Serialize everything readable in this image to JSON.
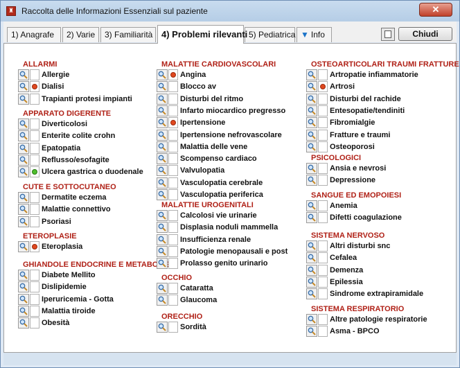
{
  "window": {
    "title": "Raccolta delle Informazioni Essenziali sul paziente"
  },
  "tabs": [
    {
      "label": "1) Anagrafe",
      "active": false
    },
    {
      "label": "2) Varie",
      "active": false
    },
    {
      "label": "3) Familiarità",
      "active": false
    },
    {
      "label": "4) Problemi rilevanti",
      "active": true
    },
    {
      "label": "5) Pediatrica",
      "active": false
    },
    {
      "label": "Info",
      "active": false
    }
  ],
  "toolbar": {
    "close_label": "Chiudi",
    "calculator_icon": "calculator-icon"
  },
  "colors": {
    "category": "#b02117",
    "dot_red": "#e0481f",
    "dot_green": "#4fbf2d"
  },
  "categories": [
    {
      "title": "ALLARMI",
      "items": [
        {
          "label": "Allergie",
          "status": "none"
        },
        {
          "label": "Dialisi",
          "status": "red"
        },
        {
          "label": "Trapianti protesi impianti",
          "status": "none"
        }
      ]
    },
    {
      "title": "APPARATO DIGERENTE",
      "items": [
        {
          "label": "Diverticolosi",
          "status": "none"
        },
        {
          "label": "Enterite colite crohn",
          "status": "none"
        },
        {
          "label": "Epatopatia",
          "status": "none"
        },
        {
          "label": "Reflusso/esofagite",
          "status": "none"
        },
        {
          "label": "Ulcera gastrica o duodenale",
          "status": "green"
        }
      ]
    },
    {
      "title": "CUTE E SOTTOCUTANEO",
      "items": [
        {
          "label": "Dermatite eczema",
          "status": "none"
        },
        {
          "label": "Malattie connettivo",
          "status": "none"
        },
        {
          "label": "Psoriasi",
          "status": "none"
        }
      ]
    },
    {
      "title": "ETEROPLASIE",
      "items": [
        {
          "label": "Eteroplasia",
          "status": "red"
        }
      ]
    },
    {
      "title": "GHIANDOLE ENDOCRINE E METABOLISM",
      "items": [
        {
          "label": "Diabete Mellito",
          "status": "none"
        },
        {
          "label": "Dislipidemie",
          "status": "none"
        },
        {
          "label": "Iperuricemia - Gotta",
          "status": "none"
        },
        {
          "label": "Malattia tiroide",
          "status": "none"
        },
        {
          "label": "Obesità",
          "status": "none"
        }
      ]
    },
    {
      "title": "MALATTIE CARDIOVASCOLARI",
      "items": [
        {
          "label": "Angina",
          "status": "red"
        },
        {
          "label": "Blocco av",
          "status": "none"
        },
        {
          "label": "Disturbi del ritmo",
          "status": "none"
        },
        {
          "label": "Infarto miocardico pregresso",
          "status": "none"
        },
        {
          "label": "Ipertensione",
          "status": "red"
        },
        {
          "label": "Ipertensione nefrovascolare",
          "status": "none"
        },
        {
          "label": "Malattia delle vene",
          "status": "none"
        },
        {
          "label": "Scompenso cardiaco",
          "status": "none"
        },
        {
          "label": "Valvulopatia",
          "status": "none"
        },
        {
          "label": "Vasculopatia cerebrale",
          "status": "none"
        },
        {
          "label": "Vasculopatia periferica",
          "status": "none"
        }
      ]
    },
    {
      "title": "MALATTIE UROGENITALI",
      "items": [
        {
          "label": "Calcolosi vie urinarie",
          "status": "none"
        },
        {
          "label": "Displasia noduli mammella",
          "status": "none"
        },
        {
          "label": "Insufficienza renale",
          "status": "none"
        },
        {
          "label": "Patologie menopausali e post",
          "status": "none"
        },
        {
          "label": "Prolasso genito urinario",
          "status": "none"
        }
      ]
    },
    {
      "title": "OCCHIO",
      "items": [
        {
          "label": "Cataratta",
          "status": "none"
        },
        {
          "label": "Glaucoma",
          "status": "none"
        }
      ]
    },
    {
      "title": "ORECCHIO",
      "items": [
        {
          "label": "Sordità",
          "status": "none"
        }
      ]
    },
    {
      "title": "OSTEOARTICOLARI TRAUMI FRATTURE",
      "items": [
        {
          "label": "Artropatie infiammatorie",
          "status": "none"
        },
        {
          "label": "Artrosi",
          "status": "red"
        },
        {
          "label": "Disturbi del rachide",
          "status": "none"
        },
        {
          "label": "Entesopatie/tendiniti",
          "status": "none"
        },
        {
          "label": "Fibromialgie",
          "status": "none"
        },
        {
          "label": "Fratture e traumi",
          "status": "none"
        },
        {
          "label": "Osteoporosi",
          "status": "none"
        }
      ]
    },
    {
      "title": "PSICOLOGICI",
      "items": [
        {
          "label": "Ansia e nevrosi",
          "status": "none"
        },
        {
          "label": "Depressione",
          "status": "none"
        }
      ]
    },
    {
      "title": "SANGUE ED EMOPOIESI",
      "items": [
        {
          "label": "Anemia",
          "status": "none"
        },
        {
          "label": "Difetti coagulazione",
          "status": "none"
        }
      ]
    },
    {
      "title": "SISTEMA NERVOSO",
      "items": [
        {
          "label": "Altri disturbi snc",
          "status": "none"
        },
        {
          "label": "Cefalea",
          "status": "none"
        },
        {
          "label": "Demenza",
          "status": "none"
        },
        {
          "label": "Epilessia",
          "status": "none"
        },
        {
          "label": "Sindrome extrapiramidale",
          "status": "none"
        }
      ]
    },
    {
      "title": "SISTEMA RESPIRATORIO",
      "items": [
        {
          "label": "Altre patologie respiratorie",
          "status": "none"
        },
        {
          "label": "Asma - BPCO",
          "status": "none"
        }
      ]
    }
  ]
}
